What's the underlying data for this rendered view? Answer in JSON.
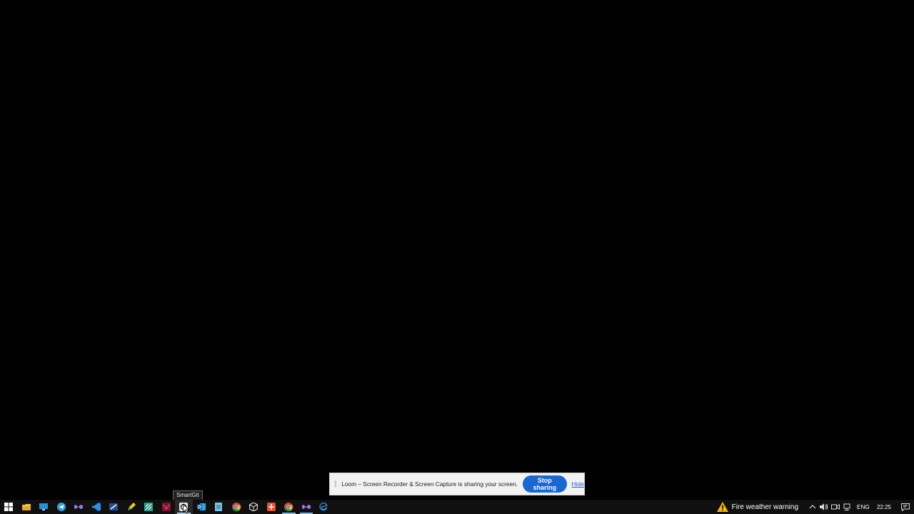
{
  "tooltip": {
    "text": "SmartGit"
  },
  "loom_banner": {
    "message": "Loom – Screen Recorder & Screen Capture is sharing your screen.",
    "stop_label": "Stop sharing",
    "hide_label": "Hide"
  },
  "taskbar": {
    "apps": [
      {
        "name": "start-menu-icon"
      },
      {
        "name": "file-explorer-icon"
      },
      {
        "name": "remote-desktop-icon"
      },
      {
        "name": "telegram-icon"
      },
      {
        "name": "visual-studio-icon"
      },
      {
        "name": "vscode-icon"
      },
      {
        "name": "azure-data-studio-icon"
      },
      {
        "name": "pen-tool-icon"
      },
      {
        "name": "app-icon"
      },
      {
        "name": "app-icon"
      },
      {
        "name": "smartgit-icon",
        "hovered": true,
        "active": true
      },
      {
        "name": "outlook-icon"
      },
      {
        "name": "notepad-icon"
      },
      {
        "name": "chrome-icon"
      },
      {
        "name": "unity-icon"
      },
      {
        "name": "app-icon"
      },
      {
        "name": "chrome-icon",
        "active": true
      },
      {
        "name": "visual-studio-icon",
        "active": true
      },
      {
        "name": "edge-icon"
      }
    ],
    "weather_text": "Fire weather warning",
    "language": "ENG",
    "time": "22:25"
  },
  "colors": {
    "accent": "#1a66d2",
    "taskbar": "#101010",
    "banner": "#f2f2f2",
    "warning": "#f5b800"
  }
}
